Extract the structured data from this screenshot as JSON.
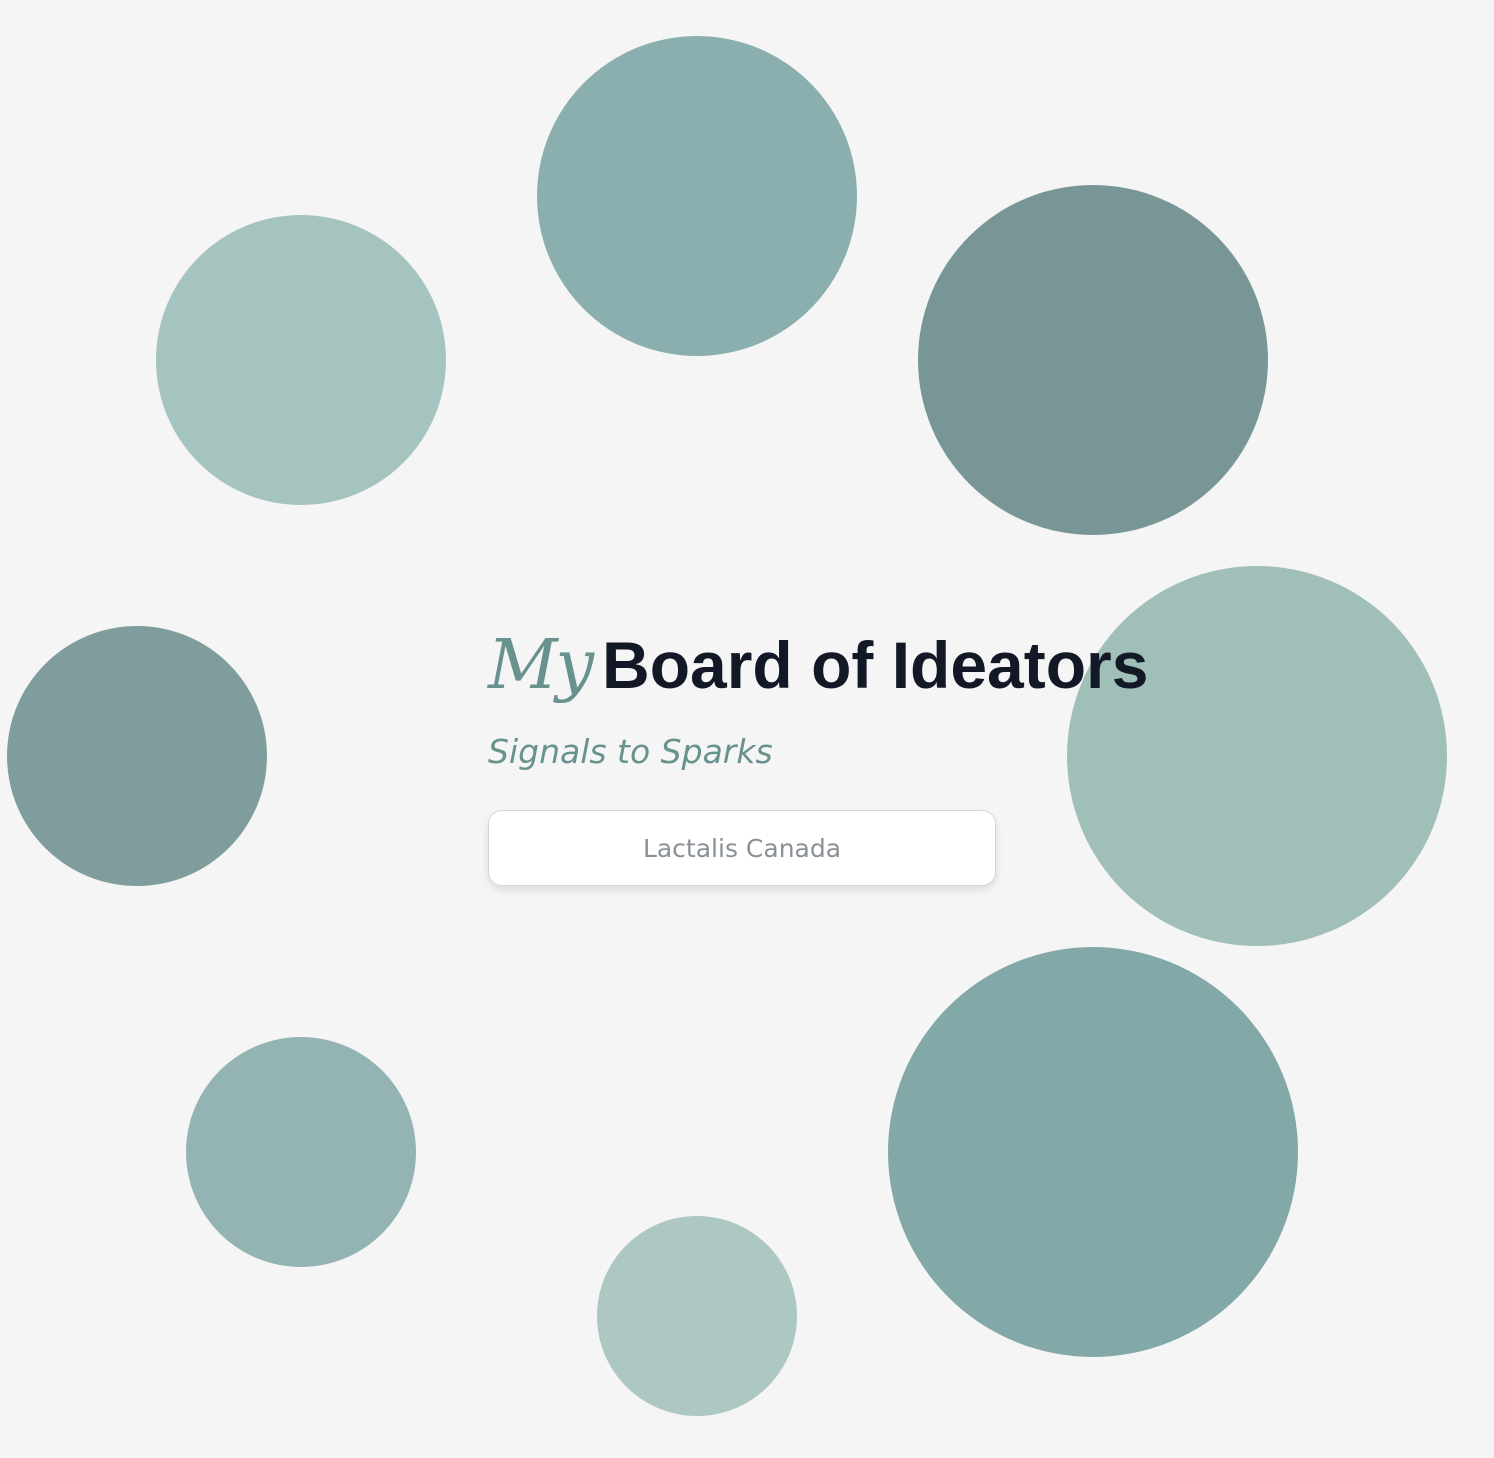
{
  "hero": {
    "title_prefix": "My",
    "title_main": "Board of Ideators",
    "subtitle": "Signals to Sparks",
    "company_input": {
      "value": "",
      "placeholder": "Lactalis Canada"
    }
  },
  "colors": {
    "background": "#f5f5f5",
    "title_text": "#121826",
    "accent_teal": "#67928e",
    "placeholder_text": "#8a9096",
    "bubble_top": "#8baeae",
    "bubble_upper_right": "#789695",
    "bubble_upper_left": "#a6c4bf",
    "bubble_left": "#809d9d",
    "bubble_right": "#a0bfb9",
    "bubble_lower_right": "#83a8a8",
    "bubble_lower_left": "#93b4b3",
    "bubble_bottom": "#adc7c3"
  }
}
